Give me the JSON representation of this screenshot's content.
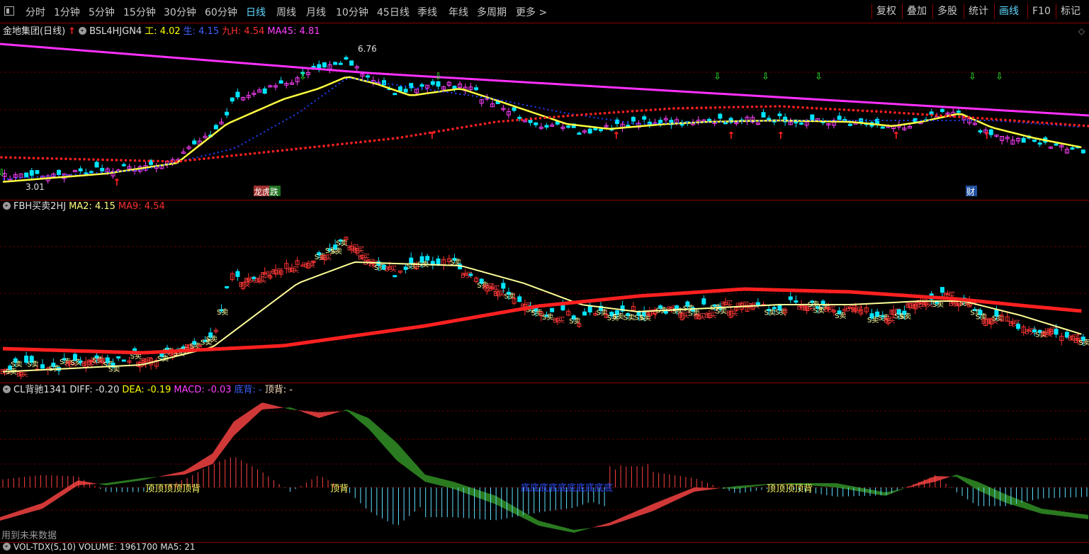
{
  "toolbar": {
    "periods": [
      "分时",
      "1分钟",
      "5分钟",
      "15分钟",
      "30分钟",
      "60分钟",
      "日线",
      "周线",
      "月线",
      "10分钟",
      "45日线",
      "季线",
      "年线",
      "多周期",
      "更多 >"
    ],
    "active_period": "日线",
    "right_buttons": [
      "复权",
      "叠加",
      "多股",
      "统计",
      "画线",
      "F10",
      "标记"
    ],
    "active_right": "画线"
  },
  "pane1": {
    "stock": "金地集团(日线)",
    "indicator": "BSL4HJGN4",
    "vals": [
      {
        "label": "工: 4.02",
        "color": "#ffff00"
      },
      {
        "label": "生: 4.15",
        "color": "#4060ff"
      },
      {
        "label": "九H: 4.54",
        "color": "#ff3030"
      },
      {
        "label": "MA45: 4.81",
        "color": "#ff40ff"
      }
    ],
    "high_label": "6.76",
    "low_label": "3.01",
    "tag1": "龙虎榜",
    "tag2": "跌",
    "tag3": "财"
  },
  "pane2": {
    "indicator": "FBH买卖2HJ",
    "vals": [
      {
        "label": "MA2: 4.15",
        "color": "#ffff80"
      },
      {
        "label": "MA9: 4.54",
        "color": "#ff3030"
      }
    ]
  },
  "pane3": {
    "indicator": "CL背驰1341",
    "vals": [
      {
        "label": "DIFF: -0.20",
        "color": "#e0e0e0"
      },
      {
        "label": "DEA: -0.19",
        "color": "#ffff00"
      },
      {
        "label": "MACD: -0.03",
        "color": "#ff40ff"
      },
      {
        "label": "底背: -",
        "color": "#4060ff"
      },
      {
        "label": "顶背: -",
        "color": "#ffe0c0"
      }
    ],
    "tag_top": "顶背",
    "footer": "用到未来数据"
  },
  "pane4": {
    "partial": "VOL-TDX(5,10)  VOLUME: 1961700  MA5: 21"
  }
}
